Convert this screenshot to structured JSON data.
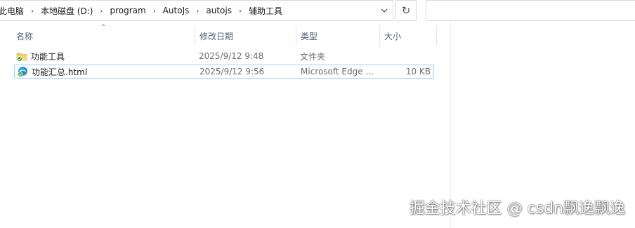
{
  "address_bar": {
    "breadcrumbs": [
      "此电脑",
      "本地磁盘 (D:)",
      "program",
      "AutoJs",
      "autojs",
      "辅助工具"
    ],
    "dropdown_icon": "chevron-down-icon",
    "refresh_icon": "refresh-icon"
  },
  "search": {
    "placeholder": ""
  },
  "columns": {
    "name": "名称",
    "date": "修改日期",
    "type": "类型",
    "size": "大小"
  },
  "files": [
    {
      "name": "功能工具",
      "date": "2025/9/12 9:48",
      "type": "文件夹",
      "size": "",
      "icon": "folder-synced-icon",
      "selected": false
    },
    {
      "name": "功能汇总.html",
      "date": "2025/9/12 9:56",
      "type": "Microsoft Edge ...",
      "size": "10 KB",
      "icon": "edge-html-synced-icon",
      "selected": true
    }
  ],
  "watermark": "掘金技术社区 @ csdn飘逸飘逸",
  "colors": {
    "header_text": "#4c607a",
    "selection_border": "#99d1ff",
    "sync_check": "#2e9e44",
    "folder": "#f2c94c"
  }
}
